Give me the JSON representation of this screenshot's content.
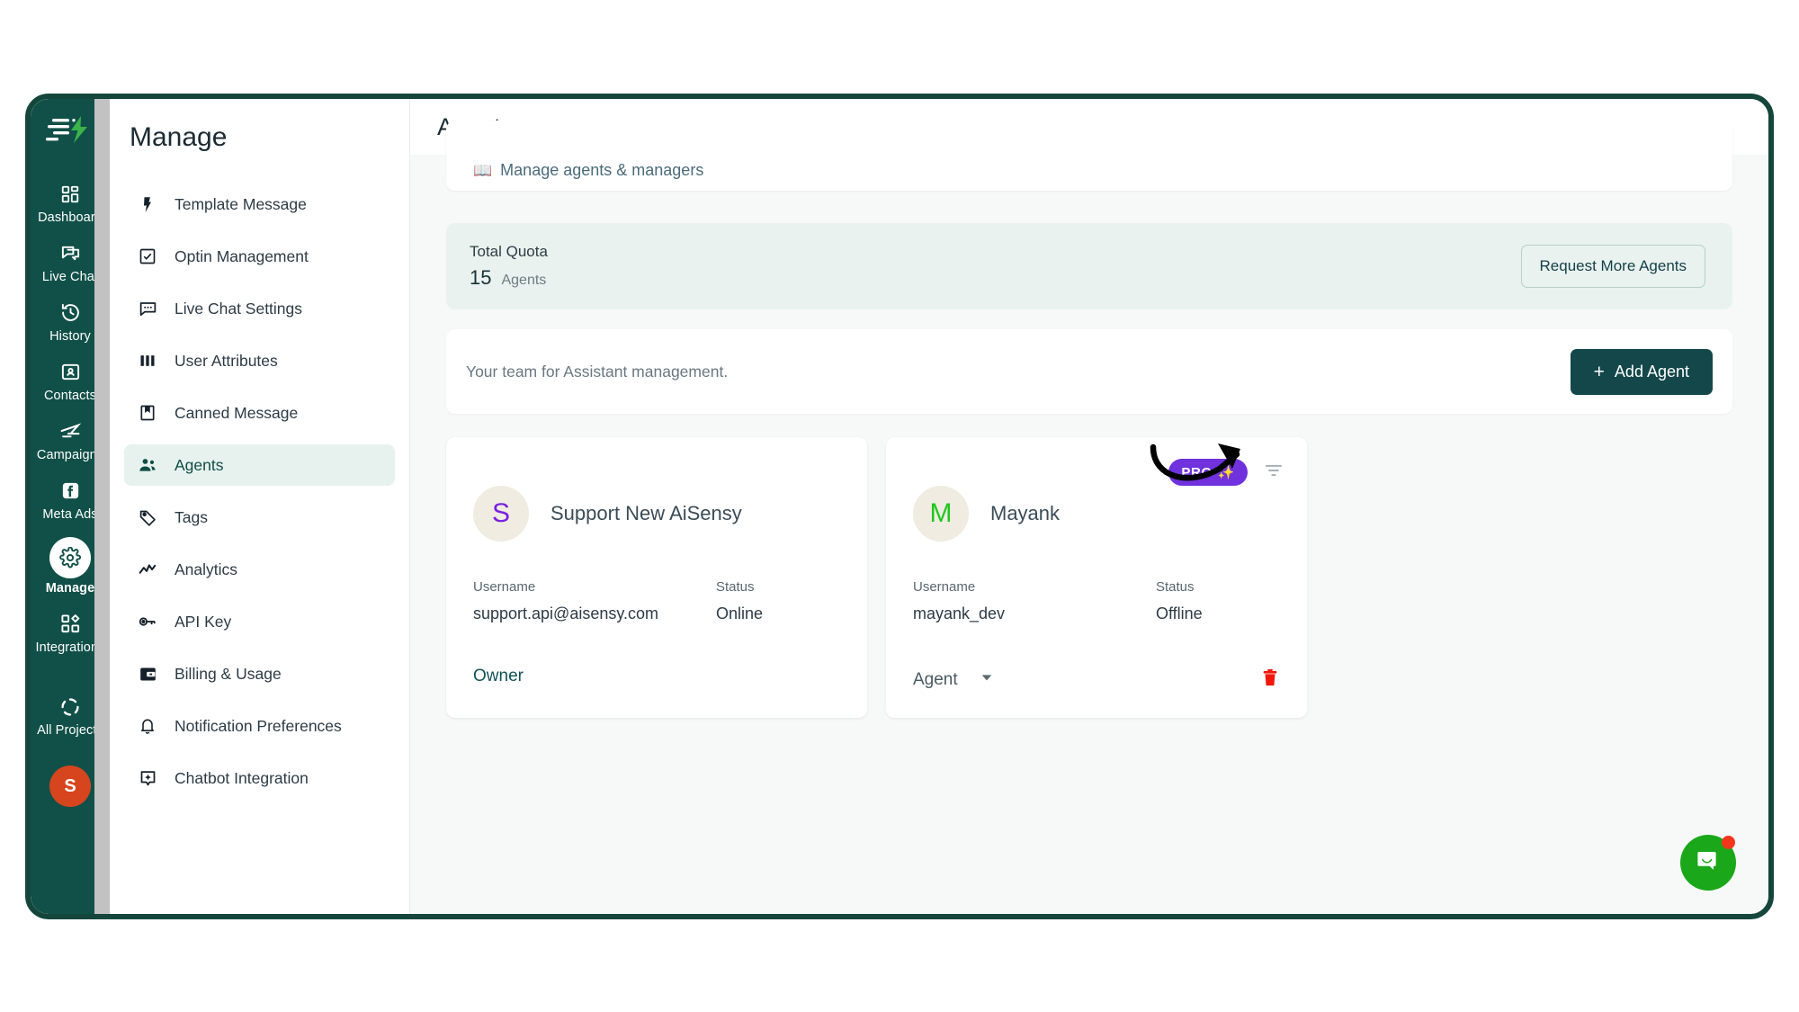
{
  "app": {
    "logo_icon": "aisensy-logo-icon",
    "frame_border_color": "#14463c"
  },
  "rail": {
    "avatar_initial": "S",
    "items": [
      {
        "label": "Dashboard",
        "icon": "dashboard-grid-icon"
      },
      {
        "label": "Live Chat",
        "icon": "chat-bubbles-icon"
      },
      {
        "label": "History",
        "icon": "clock-history-icon"
      },
      {
        "label": "Contacts",
        "icon": "contacts-card-icon"
      },
      {
        "label": "Campaigns",
        "icon": "paper-plane-icon"
      },
      {
        "label": "Meta Ads",
        "icon": "facebook-icon"
      },
      {
        "label": "Manage",
        "icon": "gear-icon"
      },
      {
        "label": "Integrations",
        "icon": "integrations-blocks-icon"
      },
      {
        "label": "All Projects",
        "icon": "projects-circle-icon"
      }
    ],
    "active": "Manage"
  },
  "subnav": {
    "title": "Manage",
    "active": "Agents",
    "items": [
      {
        "label": "Template Message",
        "icon": "bolt-icon"
      },
      {
        "label": "Optin Management",
        "icon": "checkbox-icon"
      },
      {
        "label": "Live Chat Settings",
        "icon": "chat-dots-icon"
      },
      {
        "label": "User Attributes",
        "icon": "columns-icon"
      },
      {
        "label": "Canned Message",
        "icon": "bookmark-book-icon"
      },
      {
        "label": "Agents",
        "icon": "people-icon"
      },
      {
        "label": "Tags",
        "icon": "tag-icon"
      },
      {
        "label": "Analytics",
        "icon": "trend-line-icon"
      },
      {
        "label": "API Key",
        "icon": "key-icon"
      },
      {
        "label": "Billing & Usage",
        "icon": "wallet-icon"
      },
      {
        "label": "Notification Preferences",
        "icon": "bell-icon"
      },
      {
        "label": "Chatbot Integration",
        "icon": "chatbot-spark-icon"
      }
    ]
  },
  "main": {
    "header_title": "Agents",
    "intro_emoji": "📖",
    "intro_text": "Manage agents & managers",
    "quota": {
      "label": "Total Quota",
      "value": "15",
      "unit": "Agents",
      "request_button": "Request More Agents"
    },
    "team": {
      "description": "Your team for Assistant management.",
      "add_button": "Add Agent",
      "add_button_plus": "+"
    },
    "cards": [
      {
        "avatar_initial": "S",
        "avatar_color": "#7a21e0",
        "name": "Support New AiSensy",
        "username_label": "Username",
        "username_value": "support.api@aisensy.com",
        "status_label": "Status",
        "status_value": "Online",
        "role_label": "Owner",
        "role_type": "static",
        "has_pro_badge": false,
        "has_delete": false
      },
      {
        "avatar_initial": "M",
        "avatar_color": "#1fc71f",
        "name": "Mayank",
        "username_label": "Username",
        "username_value": "mayank_dev",
        "status_label": "Status",
        "status_value": "Offline",
        "role_label": "Agent",
        "role_type": "dropdown",
        "has_pro_badge": true,
        "pro_badge_text": "PRO",
        "pro_badge_emoji": "✨",
        "pro_badge_color": "#6f32dd",
        "has_delete": true,
        "delete_icon": "trash-icon",
        "filter_icon": "filter-icon"
      }
    ]
  },
  "annotation": {
    "arrow_icon": "curved-arrow-icon"
  },
  "intercom": {
    "icon": "chat-smile-icon",
    "has_unread_dot": true,
    "dot_color": "#f3361c",
    "button_color": "#1aa81a"
  }
}
